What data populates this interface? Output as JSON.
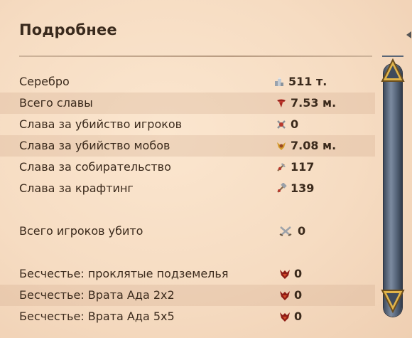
{
  "panel": {
    "title": "Подробнее"
  },
  "stats": [
    {
      "label": "Серебро",
      "icon": "silver-icon",
      "value": "511 т."
    },
    {
      "label": "Всего славы",
      "icon": "fame-icon",
      "value": "7.53 м."
    },
    {
      "label": "Слава за убийство игроков",
      "icon": "pvp-fame-icon",
      "value": "0"
    },
    {
      "label": "Слава за убийство мобов",
      "icon": "pve-fame-icon",
      "value": "7.08 м."
    },
    {
      "label": "Слава за собирательство",
      "icon": "gathering-fame-icon",
      "value": "117"
    },
    {
      "label": "Слава за крафтинг",
      "icon": "crafting-fame-icon",
      "value": "139"
    },
    {
      "label": "Всего игроков убито",
      "icon": "crossed-swords-icon",
      "value": "0"
    },
    {
      "label": "Бесчестье: проклятые подземелья",
      "icon": "infamy-icon",
      "value": "0"
    },
    {
      "label": "Бесчестье: Врата Ада 2x2",
      "icon": "infamy-icon",
      "value": "0"
    },
    {
      "label": "Бесчестье: Врата Ада 5x5",
      "icon": "infamy-icon",
      "value": "0"
    }
  ],
  "colors": {
    "background": "#f6dcc2",
    "row_shade": "#e9c8ad",
    "text": "#3b2a1c",
    "scroll_gold": "#e0b44a"
  }
}
